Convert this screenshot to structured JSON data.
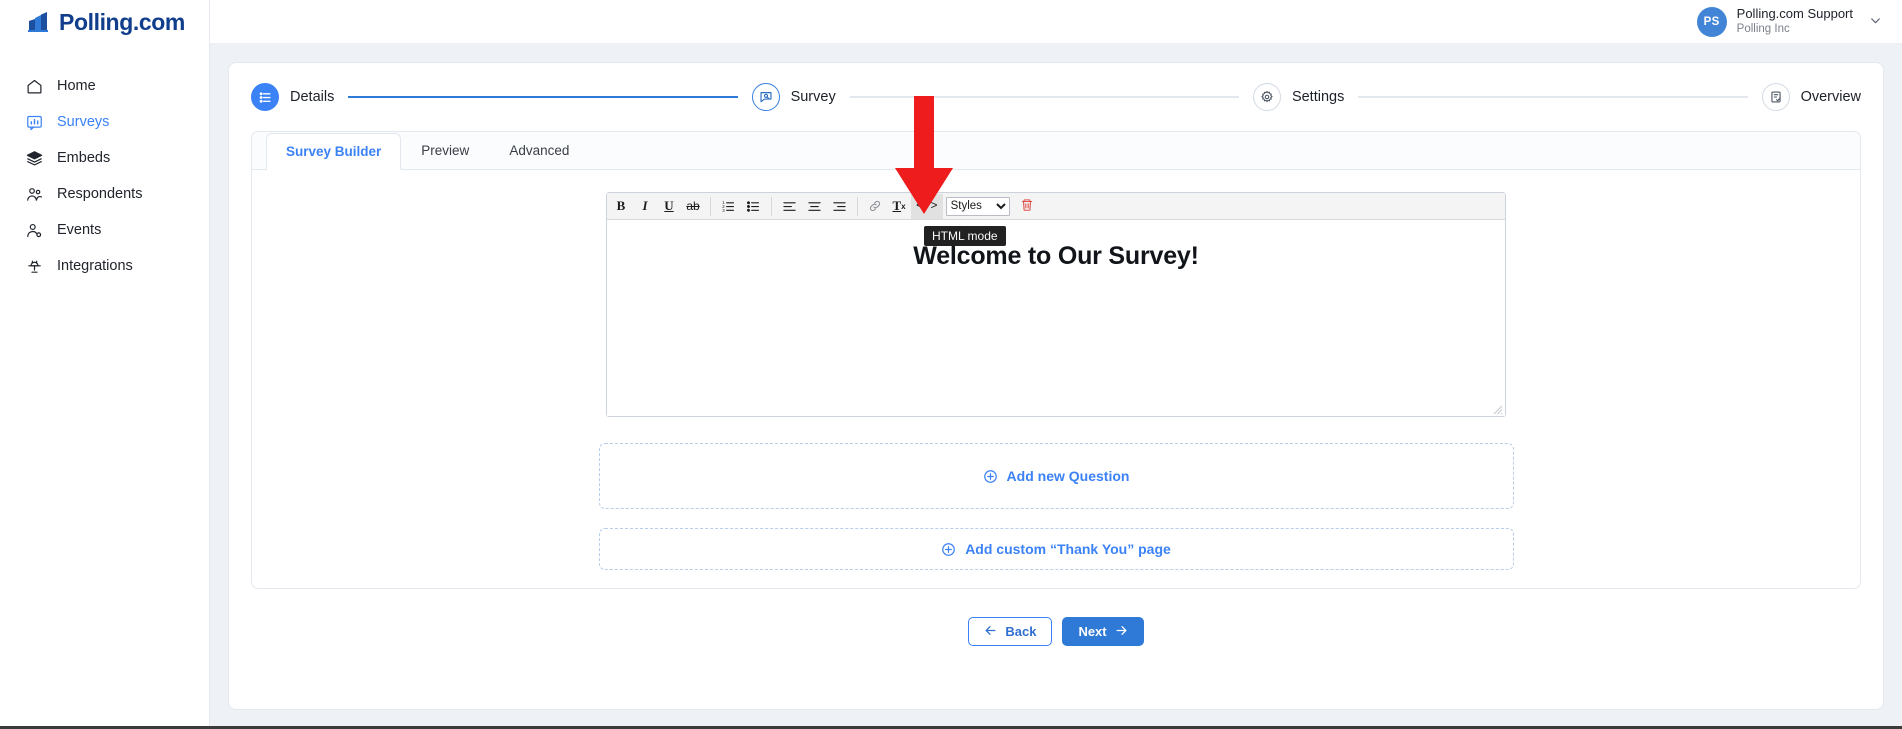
{
  "brand": {
    "name": "Polling.com",
    "logo_icon": "bar-chart-logo-icon",
    "brand_color": "#103e8c"
  },
  "sidebar": {
    "items": [
      {
        "label": "Home",
        "icon": "home-icon",
        "active": false
      },
      {
        "label": "Surveys",
        "icon": "survey-chart-icon",
        "active": true
      },
      {
        "label": "Embeds",
        "icon": "layers-icon",
        "active": false
      },
      {
        "label": "Respondents",
        "icon": "users-icon",
        "active": false
      },
      {
        "label": "Events",
        "icon": "user-gear-icon",
        "active": false
      },
      {
        "label": "Integrations",
        "icon": "plug-icon",
        "active": false
      }
    ]
  },
  "topbar": {
    "user": {
      "initials": "PS",
      "name": "Polling.com Support",
      "org": "Polling Inc",
      "avatar_color": "#4285d6",
      "chevron_icon": "chevron-down-icon"
    }
  },
  "stepper": {
    "steps": [
      {
        "label": "Details",
        "icon": "list-details-icon",
        "state": "done"
      },
      {
        "label": "Survey",
        "icon": "survey-bubble-icon",
        "state": "current"
      },
      {
        "label": "Settings",
        "icon": "gear-icon",
        "state": "upcoming"
      },
      {
        "label": "Overview",
        "icon": "clipboard-check-icon",
        "state": "upcoming"
      }
    ],
    "accent_color": "#2f7ad6"
  },
  "tabs": [
    {
      "label": "Survey Builder",
      "active": true
    },
    {
      "label": "Preview",
      "active": false
    },
    {
      "label": "Advanced",
      "active": false
    }
  ],
  "editor": {
    "toolbar": [
      {
        "name": "bold-button",
        "glyph": "B",
        "style": "bold",
        "active": false
      },
      {
        "name": "italic-button",
        "glyph": "I",
        "style": "ital",
        "active": false
      },
      {
        "name": "underline-button",
        "glyph": "U",
        "style": "under",
        "active": false
      },
      {
        "name": "strikethrough-button",
        "glyph": "ab",
        "style": "strike",
        "active": false
      }
    ],
    "list_buttons": [
      {
        "name": "ordered-list-button",
        "icon": "ordered-list-icon"
      },
      {
        "name": "unordered-list-button",
        "icon": "bullet-list-icon"
      }
    ],
    "align_buttons": [
      {
        "name": "align-left-button",
        "icon": "align-left-icon"
      },
      {
        "name": "align-center-button",
        "icon": "align-center-icon"
      },
      {
        "name": "align-right-button",
        "icon": "align-right-icon"
      }
    ],
    "link_button": {
      "name": "insert-link-button",
      "icon": "link-icon"
    },
    "remove_format_button": {
      "name": "remove-format-button",
      "glyph": "Tx"
    },
    "html_mode_button": {
      "name": "html-mode-button",
      "glyph": "</>",
      "active": true
    },
    "styles_select": {
      "name": "styles-select",
      "value": "Styles",
      "options": [
        "Styles"
      ]
    },
    "delete_button": {
      "name": "delete-block-button",
      "icon": "trash-icon",
      "color": "#e0514b"
    },
    "tooltip": "HTML mode",
    "content_heading": "Welcome to Our Survey!",
    "resize_handle_icon": "resize-grip-icon"
  },
  "blocks": [
    {
      "label": "Add new Question",
      "icon": "plus-circle-icon",
      "link_color": "#3b82f6"
    },
    {
      "label": "Add custom “Thank You” page",
      "icon": "plus-circle-icon",
      "link_color": "#3b82f6"
    }
  ],
  "footer": {
    "back": {
      "label": "Back",
      "icon": "arrow-left-icon"
    },
    "next": {
      "label": "Next",
      "icon": "arrow-right-icon"
    }
  },
  "annotation": {
    "type": "red-down-arrow",
    "color": "#ee1c1c",
    "points_at": "html-mode-button"
  }
}
